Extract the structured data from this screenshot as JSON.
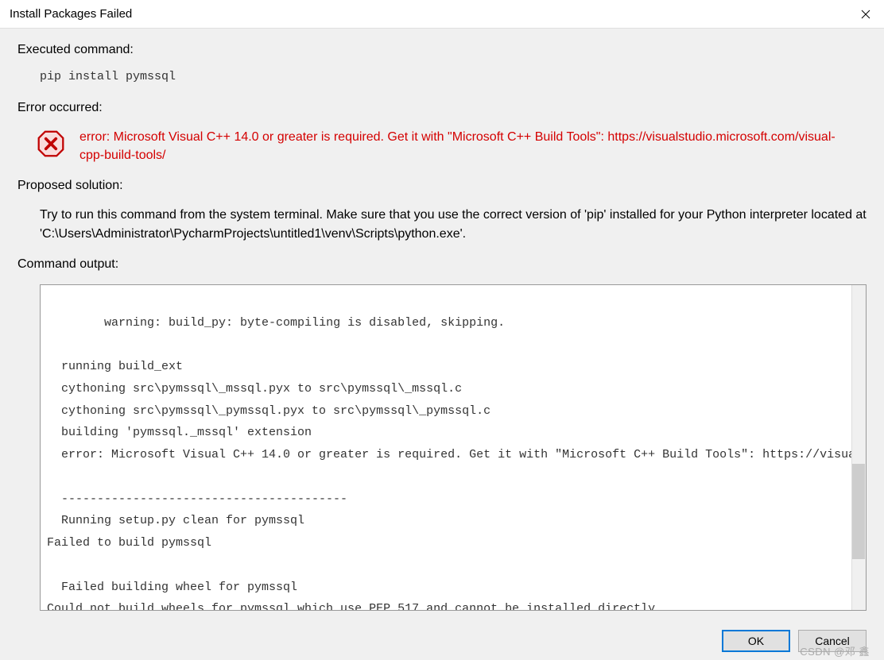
{
  "window": {
    "title": "Install Packages Failed"
  },
  "sections": {
    "executed_label": "Executed command:",
    "command": "pip install pymssql",
    "error_label": "Error occurred:",
    "error_message": "error: Microsoft Visual C++ 14.0 or greater is required. Get it with \"Microsoft C++ Build Tools\": https://visualstudio.microsoft.com/visual-cpp-build-tools/",
    "solution_label": "Proposed solution:",
    "solution_text": "Try to run this command from the system terminal. Make sure that you use the correct version of 'pip' installed for your Python interpreter located at 'C:\\Users\\Administrator\\PycharmProjects\\untitled1\\venv\\Scripts\\python.exe'.",
    "output_label": "Command output:",
    "output_text": "  warning: build_py: byte-compiling is disabled, skipping.\n\n  running build_ext\n  cythoning src\\pymssql\\_mssql.pyx to src\\pymssql\\_mssql.c\n  cythoning src\\pymssql\\_pymssql.pyx to src\\pymssql\\_pymssql.c\n  building 'pymssql._mssql' extension\n  error: Microsoft Visual C++ 14.0 or greater is required. Get it with \"Microsoft C++ Build Tools\": https://visua\n\n  ----------------------------------------\n  Running setup.py clean for pymssql\nFailed to build pymssql\n\n  Failed building wheel for pymssql\nCould not build wheels for pymssql which use PEP 517 and cannot be installed directly"
  },
  "buttons": {
    "ok": "OK",
    "cancel": "Cancel"
  },
  "watermark": "CSDN @邓 鑫"
}
